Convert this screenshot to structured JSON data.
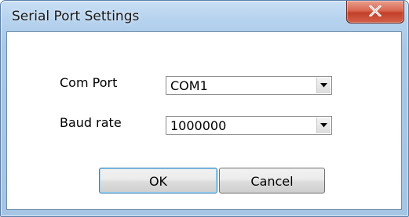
{
  "window": {
    "title": "Serial Port Settings",
    "close_icon": "close-x-icon"
  },
  "form": {
    "com_port": {
      "label": "Com Port",
      "value": "COM1",
      "dropdown_icon": "chevron-down-icon"
    },
    "baud_rate": {
      "label": "Baud rate",
      "value": "1000000",
      "dropdown_icon": "chevron-down-icon"
    }
  },
  "buttons": {
    "ok_label": "OK",
    "cancel_label": "Cancel"
  },
  "colors": {
    "title_bar": "#b5d2ee",
    "close_button": "#c2402a",
    "default_button_border": "#3c7fb1"
  }
}
